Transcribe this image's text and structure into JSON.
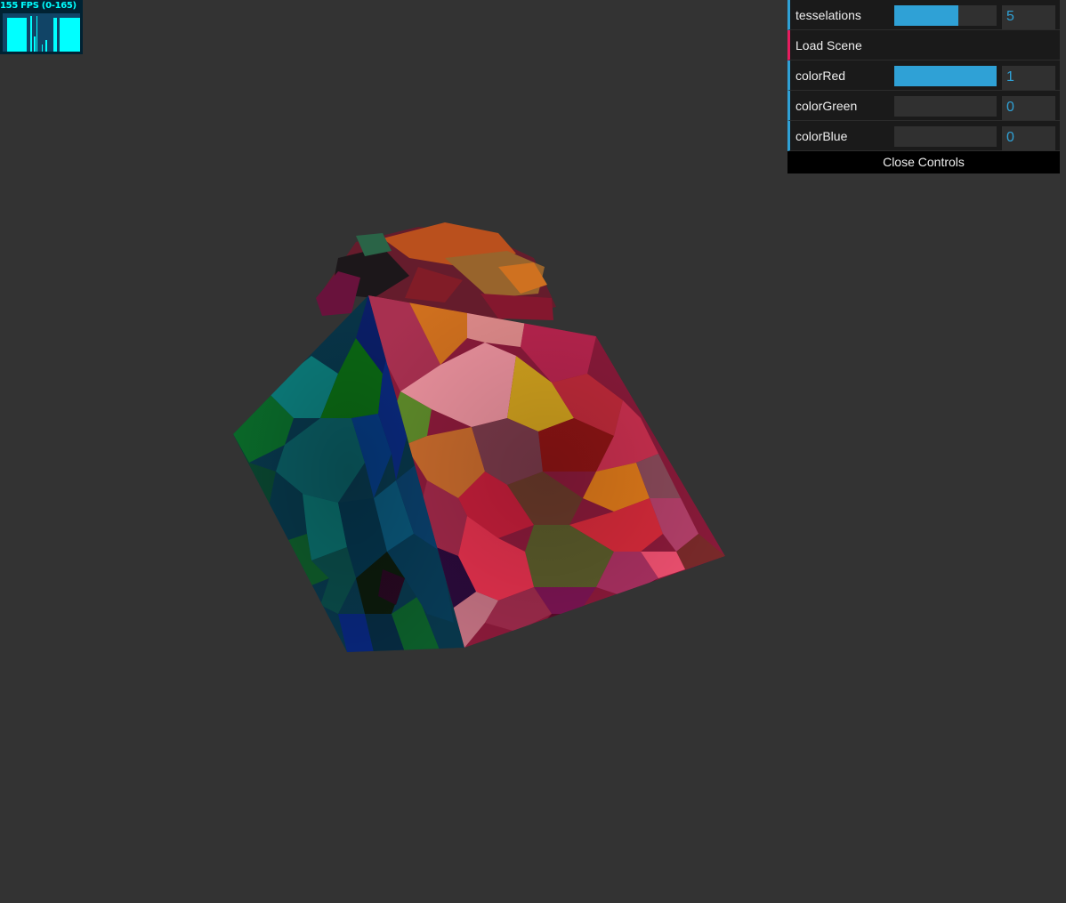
{
  "stats": {
    "fps_text": "155 FPS (0-165)",
    "colors": {
      "text": "#00ffff",
      "background": "#002233"
    }
  },
  "gui": {
    "controls": [
      {
        "label": "tesselations",
        "value": "5",
        "type": "slider",
        "fraction": 0.63
      },
      {
        "label": "Load Scene",
        "type": "button"
      },
      {
        "label": "colorRed",
        "value": "1",
        "type": "slider",
        "fraction": 1.0
      },
      {
        "label": "colorGreen",
        "value": "0",
        "type": "slider",
        "fraction": 0.0
      },
      {
        "label": "colorBlue",
        "value": "0",
        "type": "slider",
        "fraction": 0.0
      }
    ],
    "close_label": "Close Controls",
    "colors": {
      "accent": "#2fa1d6",
      "function_accent": "#e61d5f",
      "panel": "#1a1a1a"
    }
  },
  "scene": {
    "background": "#333333",
    "object": "voronoi-textured-cube"
  }
}
